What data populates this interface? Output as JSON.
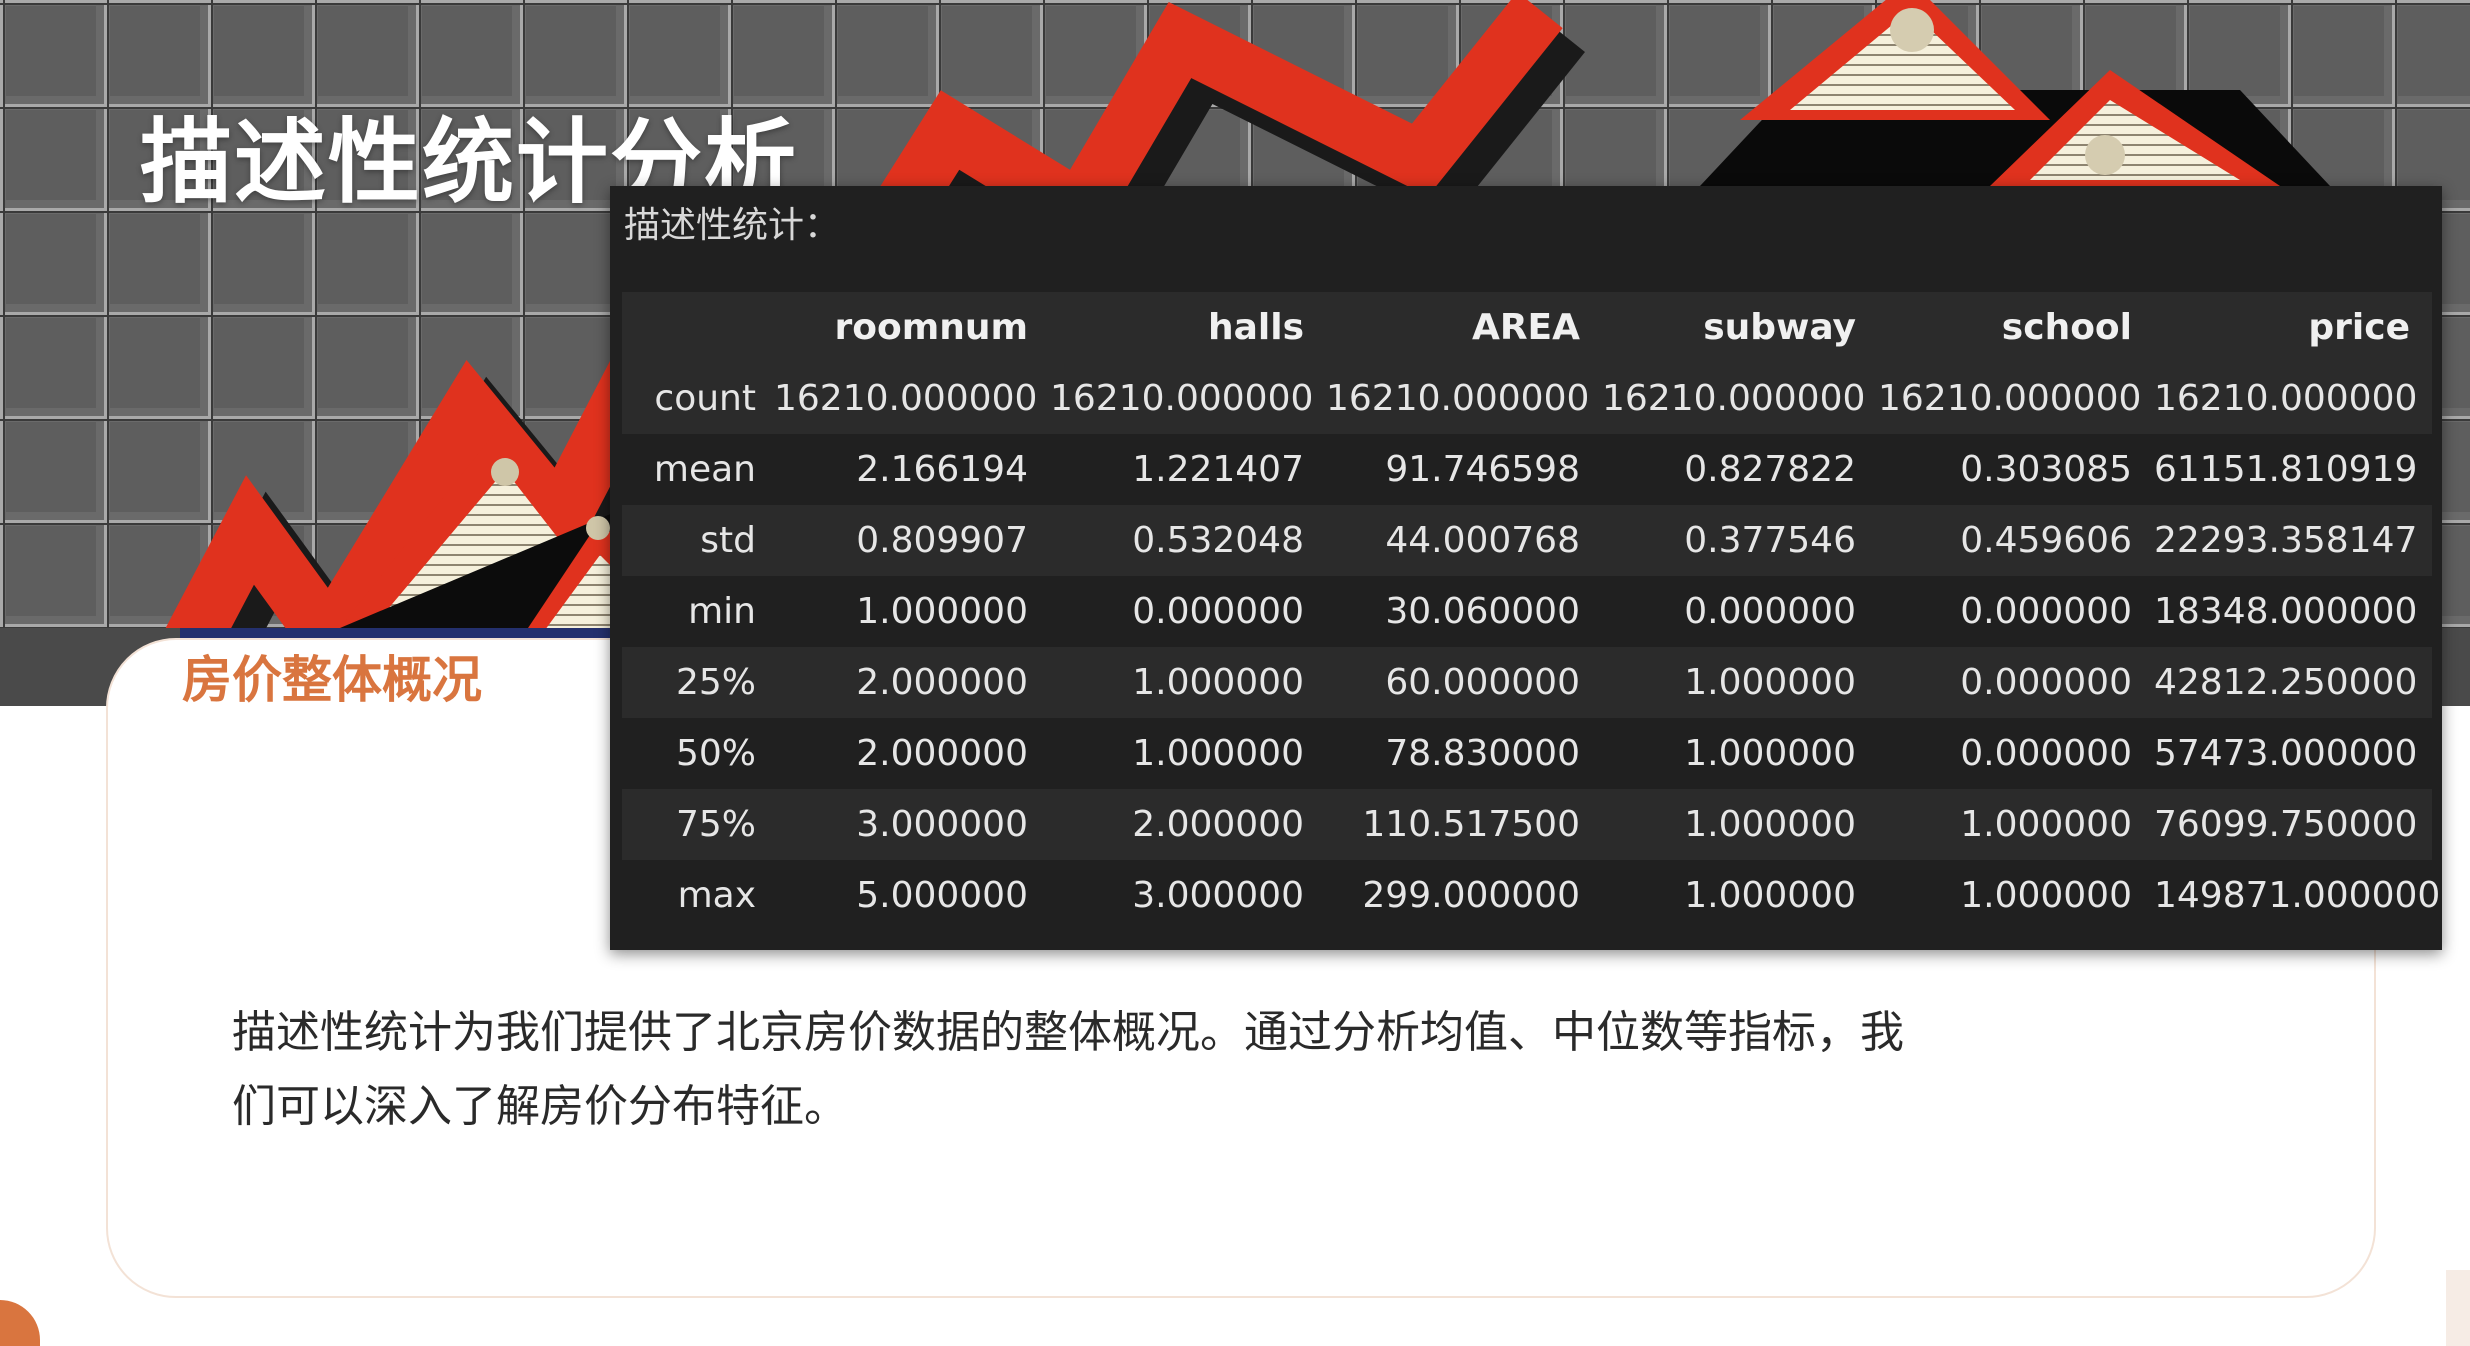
{
  "slide": {
    "title": "描述性统计分析",
    "section_title": "房价整体概况",
    "description": "描述性统计为我们提供了北京房价数据的整体概况。通过分析均值、中位数等指标，我们可以深入了解房价分布特征。"
  },
  "output": {
    "label": "描述性统计：",
    "columns": [
      "",
      "roomnum",
      "halls",
      "AREA",
      "subway",
      "school",
      "price"
    ],
    "rows": [
      {
        "index": "count",
        "values": [
          "16210.000000",
          "16210.000000",
          "16210.000000",
          "16210.000000",
          "16210.000000",
          "16210.000000"
        ]
      },
      {
        "index": "mean",
        "values": [
          "2.166194",
          "1.221407",
          "91.746598",
          "0.827822",
          "0.303085",
          "61151.810919"
        ]
      },
      {
        "index": "std",
        "values": [
          "0.809907",
          "0.532048",
          "44.000768",
          "0.377546",
          "0.459606",
          "22293.358147"
        ]
      },
      {
        "index": "min",
        "values": [
          "1.000000",
          "0.000000",
          "30.060000",
          "0.000000",
          "0.000000",
          "18348.000000"
        ]
      },
      {
        "index": "25%",
        "values": [
          "2.000000",
          "1.000000",
          "60.000000",
          "1.000000",
          "0.000000",
          "42812.250000"
        ]
      },
      {
        "index": "50%",
        "values": [
          "2.000000",
          "1.000000",
          "78.830000",
          "1.000000",
          "0.000000",
          "57473.000000"
        ]
      },
      {
        "index": "75%",
        "values": [
          "3.000000",
          "2.000000",
          "110.517500",
          "1.000000",
          "1.000000",
          "76099.750000"
        ]
      },
      {
        "index": "max",
        "values": [
          "5.000000",
          "3.000000",
          "299.000000",
          "1.000000",
          "1.000000",
          "149871.000000"
        ]
      }
    ]
  },
  "colors": {
    "accent": "#d9753f",
    "title_text": "#ffffff",
    "panel_bg": "#202020",
    "panel_row_alt": "#2b2b2b",
    "chart_red": "#e0321e",
    "grid_gray": "#6e6e6e"
  },
  "background_image": {
    "icon": "rising-red-arrow-over-houses-on-grid"
  }
}
